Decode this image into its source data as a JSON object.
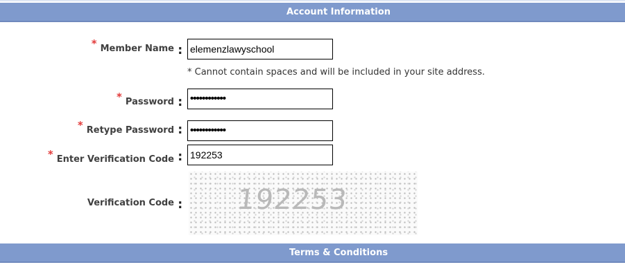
{
  "sections": {
    "account": "Account Information",
    "terms": "Terms & Conditions"
  },
  "form": {
    "required_marker": "*",
    "colon": ":",
    "member_name": {
      "label": "Member Name",
      "value": "elemenzlawyschool",
      "hint": "* Cannot contain spaces and will be included in your site address."
    },
    "password": {
      "label": "Password",
      "value_masked": "••••••••••••"
    },
    "retype_password": {
      "label": "Retype Password",
      "value_masked": "••••••••••••"
    },
    "verification_input": {
      "label": "Enter Verification Code",
      "value": "192253"
    },
    "verification_image": {
      "label": "Verification Code",
      "captcha_text": "192253"
    }
  },
  "colors": {
    "section_bar": "#7f9acd",
    "required": "#e23b3b",
    "label_text": "#404040"
  }
}
